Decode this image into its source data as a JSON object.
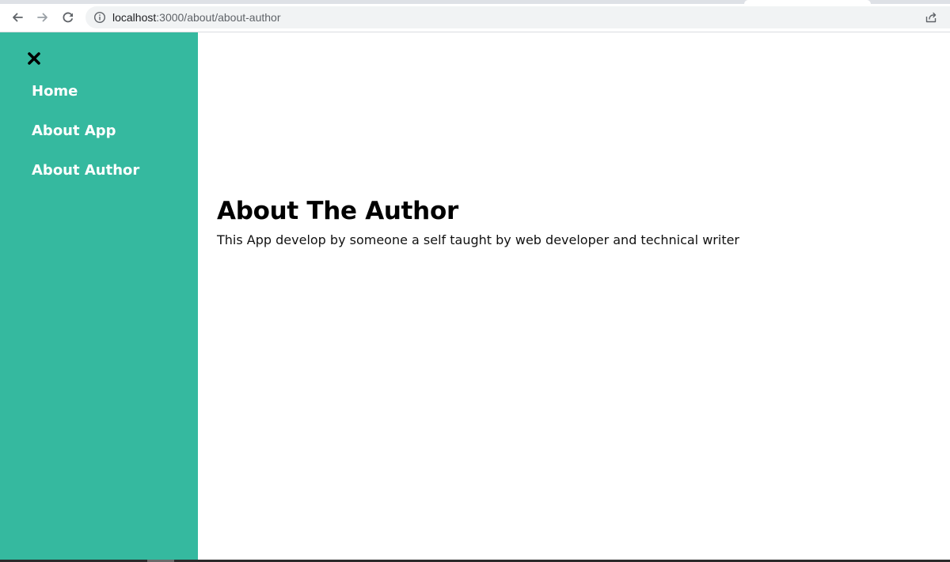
{
  "browser": {
    "url_host": "localhost",
    "url_path": ":3000/about/about-author"
  },
  "icons": {
    "back": "arrow-left-icon",
    "forward": "arrow-right-icon",
    "reload": "reload-icon",
    "info": "info-icon",
    "share": "share-icon",
    "close": "close-icon"
  },
  "colors": {
    "sidebar": "#35b99f",
    "nav_text": "#ffffff",
    "title": "#000000"
  },
  "sidebar": {
    "items": [
      {
        "label": "Home"
      },
      {
        "label": "About App"
      },
      {
        "label": "About Author"
      }
    ]
  },
  "main": {
    "title": "About The Author",
    "text": "This App develop by someone a self taught by web developer and technical writer"
  }
}
